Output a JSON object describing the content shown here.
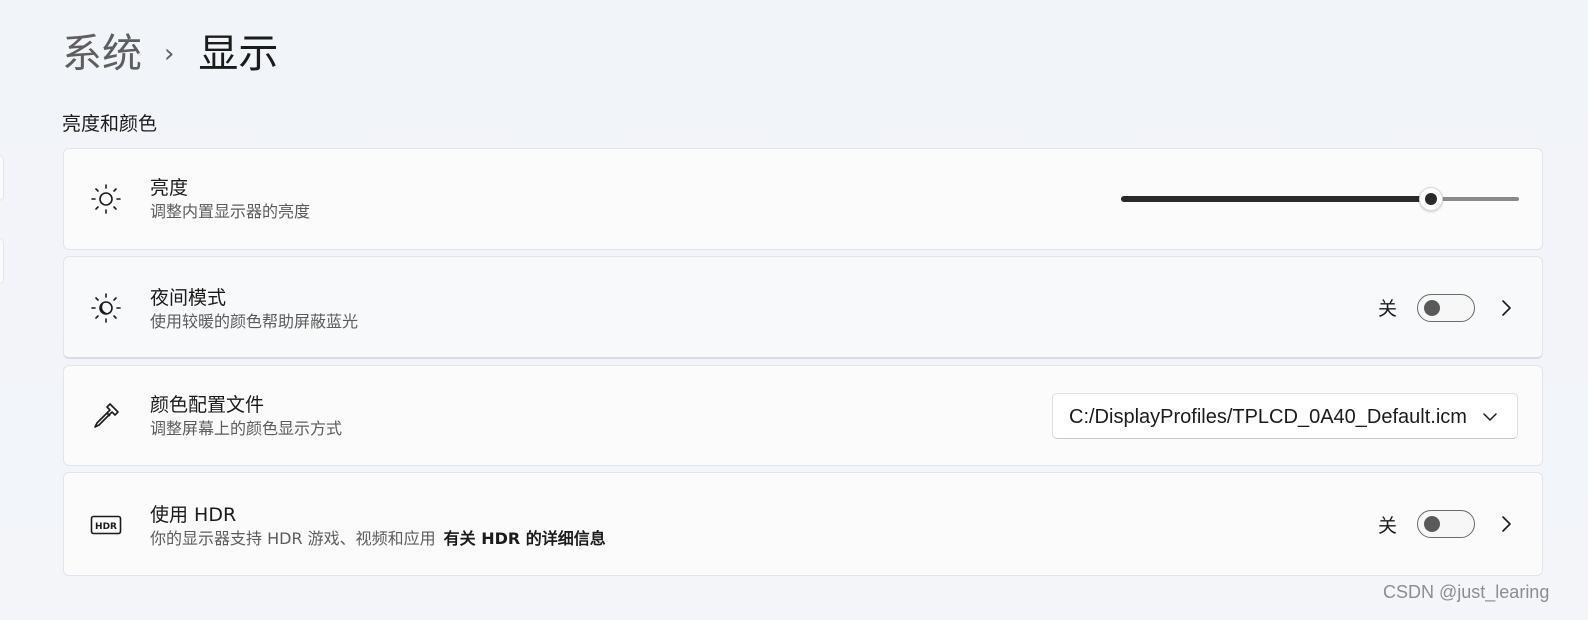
{
  "breadcrumb": {
    "parent": "系统",
    "separator": "›",
    "current": "显示"
  },
  "section": {
    "title": "亮度和颜色"
  },
  "brightness": {
    "title": "亮度",
    "subtitle": "调整内置显示器的亮度",
    "icon": "sun-icon",
    "level": 0.78
  },
  "night_light": {
    "title": "夜间模式",
    "subtitle": "使用较暖的颜色帮助屏蔽蓝光",
    "icon": "night-light-icon",
    "state_label": "关",
    "on": false
  },
  "color_profile": {
    "title": "颜色配置文件",
    "subtitle": "调整屏幕上的颜色显示方式",
    "icon": "eyedropper-icon",
    "selected": "C:/DisplayProfiles/TPLCD_0A40_Default.icm"
  },
  "hdr": {
    "title": "使用 HDR",
    "subtitle": "你的显示器支持 HDR 游戏、视频和应用",
    "link": "有关 HDR 的详细信息",
    "icon": "hdr-icon",
    "state_label": "关",
    "on": false
  },
  "watermark": "CSDN @just_learing",
  "colors": {
    "background": "#f1f4f9",
    "card": "#fbfbfc",
    "toggle_off_knob": "#5a5a5a",
    "slider_fill": "#2a2a2a"
  }
}
